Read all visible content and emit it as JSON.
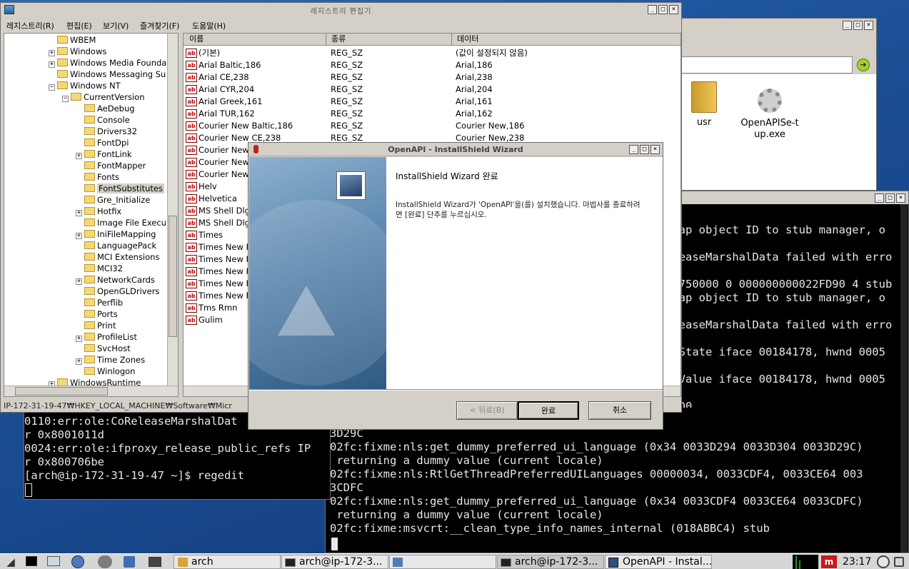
{
  "regedit": {
    "title_glyphs": "레지스트리 편집기",
    "menu": [
      "레지스트리(R)",
      "편집(E)",
      "보기(V)",
      "즐겨찾기(F)",
      "도움말(H)"
    ],
    "tree": [
      {
        "label": "WBEM",
        "indent": 0,
        "exp": ""
      },
      {
        "label": "Windows",
        "indent": 0,
        "exp": "+"
      },
      {
        "label": "Windows Media Founda",
        "indent": 0,
        "exp": "+"
      },
      {
        "label": "Windows Messaging Su",
        "indent": 0,
        "exp": ""
      },
      {
        "label": "Windows NT",
        "indent": 0,
        "exp": "-"
      },
      {
        "label": "CurrentVersion",
        "indent": 1,
        "exp": "-"
      },
      {
        "label": "AeDebug",
        "indent": 2,
        "exp": ""
      },
      {
        "label": "Console",
        "indent": 2,
        "exp": ""
      },
      {
        "label": "Drivers32",
        "indent": 2,
        "exp": ""
      },
      {
        "label": "FontDpi",
        "indent": 2,
        "exp": ""
      },
      {
        "label": "FontLink",
        "indent": 2,
        "exp": "+"
      },
      {
        "label": "FontMapper",
        "indent": 2,
        "exp": ""
      },
      {
        "label": "Fonts",
        "indent": 2,
        "exp": ""
      },
      {
        "label": "FontSubstitutes",
        "indent": 2,
        "exp": "",
        "sel": true
      },
      {
        "label": "Gre_Initialize",
        "indent": 2,
        "exp": ""
      },
      {
        "label": "Hotfix",
        "indent": 2,
        "exp": "+"
      },
      {
        "label": "Image File Execu",
        "indent": 2,
        "exp": ""
      },
      {
        "label": "IniFileMapping",
        "indent": 2,
        "exp": "+"
      },
      {
        "label": "LanguagePack",
        "indent": 2,
        "exp": ""
      },
      {
        "label": "MCI Extensions",
        "indent": 2,
        "exp": ""
      },
      {
        "label": "MCI32",
        "indent": 2,
        "exp": ""
      },
      {
        "label": "NetworkCards",
        "indent": 2,
        "exp": "+"
      },
      {
        "label": "OpenGLDrivers",
        "indent": 2,
        "exp": ""
      },
      {
        "label": "Perflib",
        "indent": 2,
        "exp": ""
      },
      {
        "label": "Ports",
        "indent": 2,
        "exp": ""
      },
      {
        "label": "Print",
        "indent": 2,
        "exp": ""
      },
      {
        "label": "ProfileList",
        "indent": 2,
        "exp": "+"
      },
      {
        "label": "SvcHost",
        "indent": 2,
        "exp": ""
      },
      {
        "label": "Time Zones",
        "indent": 2,
        "exp": "+"
      },
      {
        "label": "Winlogon",
        "indent": 2,
        "exp": ""
      },
      {
        "label": "WindowsRuntime",
        "indent": 0,
        "exp": "+"
      }
    ],
    "columns": [
      "이름",
      "종류",
      "데이터"
    ],
    "values": [
      {
        "name": "(기본)",
        "type": "REG_SZ",
        "data": "(값이 설정되지 않음)"
      },
      {
        "name": "Arial Baltic,186",
        "type": "REG_SZ",
        "data": "Arial,186"
      },
      {
        "name": "Arial CE,238",
        "type": "REG_SZ",
        "data": "Arial,238"
      },
      {
        "name": "Arial CYR,204",
        "type": "REG_SZ",
        "data": "Arial,204"
      },
      {
        "name": "Arial Greek,161",
        "type": "REG_SZ",
        "data": "Arial,161"
      },
      {
        "name": "Arial TUR,162",
        "type": "REG_SZ",
        "data": "Arial,162"
      },
      {
        "name": "Courier New Baltic,186",
        "type": "REG_SZ",
        "data": "Courier New,186"
      },
      {
        "name": "Courier New CE,238",
        "type": "REG_SZ",
        "data": "Courier New,238"
      },
      {
        "name": "Courier New",
        "type": "",
        "data": ""
      },
      {
        "name": "Courier New",
        "type": "",
        "data": ""
      },
      {
        "name": "Courier New",
        "type": "",
        "data": ""
      },
      {
        "name": "Helv",
        "type": "",
        "data": ""
      },
      {
        "name": "Helvetica",
        "type": "",
        "data": ""
      },
      {
        "name": "MS Shell Dlg",
        "type": "",
        "data": ""
      },
      {
        "name": "MS Shell Dlg",
        "type": "",
        "data": ""
      },
      {
        "name": "Times",
        "type": "",
        "data": ""
      },
      {
        "name": "Times New R",
        "type": "",
        "data": ""
      },
      {
        "name": "Times New R",
        "type": "",
        "data": ""
      },
      {
        "name": "Times New R",
        "type": "",
        "data": ""
      },
      {
        "name": "Times New R",
        "type": "",
        "data": ""
      },
      {
        "name": "Times New R",
        "type": "",
        "data": ""
      },
      {
        "name": "Tms Rmn",
        "type": "",
        "data": ""
      },
      {
        "name": "Gulim",
        "type": "",
        "data": ""
      }
    ],
    "status": "IP-172-31-19-47₩HKEY_LOCAL_MACHINE₩Software₩Micr"
  },
  "filemanager": {
    "items": [
      {
        "label": "usr",
        "icon": "folder-icon"
      },
      {
        "label": "OpenAPISe-tup.exe",
        "icon": "gear-icon"
      }
    ]
  },
  "wizard": {
    "title": "OpenAPI - InstallShield Wizard",
    "heading": "InstallShield Wizard 완료",
    "body": "InstallShield Wizard가 'OpenAPI'을(를) 설치했습니다. 마법사를 종료하려면 [완료] 단추를 누르십시오.",
    "back": "< 뒤로(B)",
    "finish": "완료",
    "cancel": "취소"
  },
  "term_left": {
    "lines": [
      "0110:err:ole:CoReleaseMarshalDat",
      "r 0x8001011d",
      "0024:err:ole:ifproxy_release_public_refs IP",
      "r 0x800706be",
      "[arch@ip-172-31-19-47 ~]$ regedit"
    ]
  },
  "term_right": {
    "lines": [
      " map object ID to stub manager, o",
      "",
      "eleaseMarshalData failed with erro",
      "",
      "00750000 0 000000000022FD90 4 stub",
      " map object ID to stub manager, o",
      "",
      "eleaseMarshalData failed with erro",
      "",
      "ssState iface 00184178, hwnd 0005",
      "",
      "ssValue iface 00184178, hwnd 0005",
      "",
      "BDD0",
      " 00000034, 0033D294, 0033D304 003"
    ],
    "lines_full": [
      "3D29C",
      "02fc:fixme:nls:get_dummy_preferred_ui_language (0x34 0033D294 0033D304 0033D29C)",
      " returning a dummy value (current locale)",
      "02fc:fixme:nls:RtlGetThreadPreferredUILanguages 00000034, 0033CDF4, 0033CE64 003",
      "3CDFC",
      "02fc:fixme:nls:get_dummy_preferred_ui_language (0x34 0033CDF4 0033CE64 0033CDFC)",
      " returning a dummy value (current locale)",
      "02fc:fixme:msvcrt:__clean_type_info_names_internal (018ABBC4) stub"
    ]
  },
  "taskbar": {
    "items": [
      "arch",
      "arch@ip-172-3...",
      "",
      "arch@ip-172-3...",
      "OpenAPI - Instal..."
    ],
    "clock": "23:17"
  }
}
